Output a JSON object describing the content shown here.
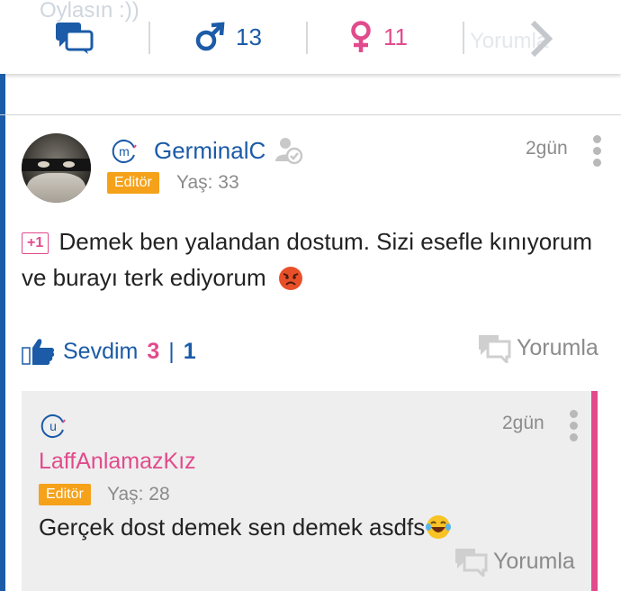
{
  "top_bar": {
    "ghost_title": "Oylasın :))",
    "ghost_comment_label": "Yorumla",
    "male_count": "13",
    "female_count": "11"
  },
  "post": {
    "author": "GerminalC",
    "level_letter": "m",
    "role_badge": "Editör",
    "age": "Yaş: 33",
    "time": "2gün",
    "plus_badge": "+1",
    "text": "Demek ben yalandan dostum. Sizi esefle kınıyorum ve burayı terk ediyorum",
    "like_label": "Sevdim",
    "like_count": "3",
    "separator": "|",
    "dislike_count": "1",
    "comment_label": "Yorumla"
  },
  "reply": {
    "author": "LaffAnlamazKız",
    "level_letter": "u",
    "role_badge": "Editör",
    "age": "Yaş: 28",
    "time": "2gün",
    "text": "Gerçek dost demek sen demek asdfs",
    "comment_label": "Yorumla"
  },
  "colors": {
    "brand_blue": "#1b5ba7",
    "brand_pink": "#e14b8c",
    "editor_orange": "#f5a21a"
  },
  "icons": [
    "chat-bubbles-icon",
    "male-icon",
    "female-icon",
    "chevron-right-icon",
    "verified-user-icon",
    "thumbs-up-icon",
    "comment-icon",
    "more-vertical-icon",
    "angry-face-emoji",
    "laughing-tears-emoji"
  ]
}
